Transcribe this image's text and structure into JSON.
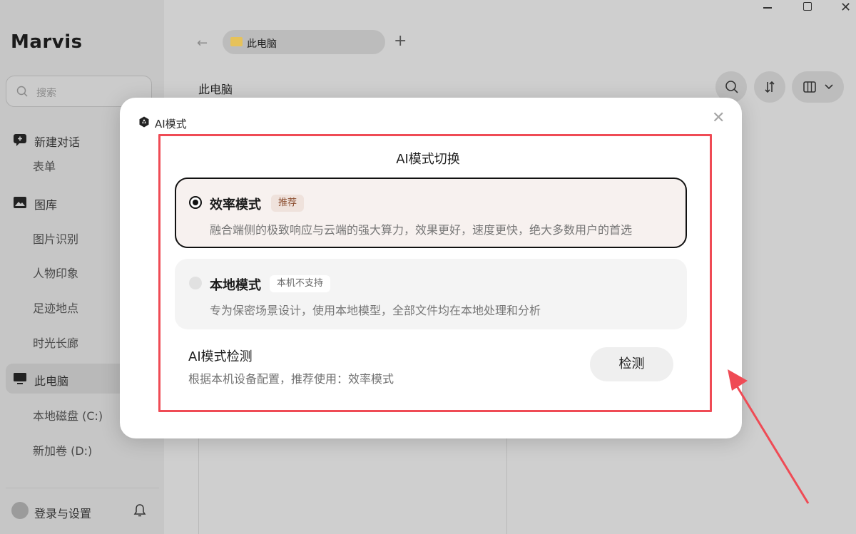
{
  "app": {
    "brand": "Marvis",
    "search_placeholder": "搜索",
    "sidebar": {
      "new_chat": "新建对话",
      "form": "表单",
      "gallery": "图库",
      "gallery_items": [
        "图片识别",
        "人物印象",
        "足迹地点",
        "时光长廊"
      ],
      "this_pc": "此电脑",
      "drives": [
        "本地磁盘 (C:)",
        "新加卷 (D:)"
      ],
      "login": "登录与设置"
    },
    "tab_title": "此电脑",
    "breadcrumb": "此电脑"
  },
  "modal": {
    "title": "AI模式",
    "section_title": "AI模式切换",
    "modes": [
      {
        "name": "效率模式",
        "badge": "推荐",
        "description": "融合端侧的极致响应与云端的强大算力，效果更好，速度更快，绝大多数用户的首选",
        "selected": true
      },
      {
        "name": "本地模式",
        "badge": "本机不支持",
        "description": "专为保密场景设计，使用本地模型，全部文件均在本地处理和分析",
        "selected": false
      }
    ],
    "detect": {
      "title": "AI模式检测",
      "description": "根据本机设备配置，推荐使用：效率模式",
      "button": "检测"
    }
  },
  "colors": {
    "highlight": "#ef4b55",
    "recommend_badge": "#efe2dc",
    "selected_card": "#f7f1ef"
  }
}
